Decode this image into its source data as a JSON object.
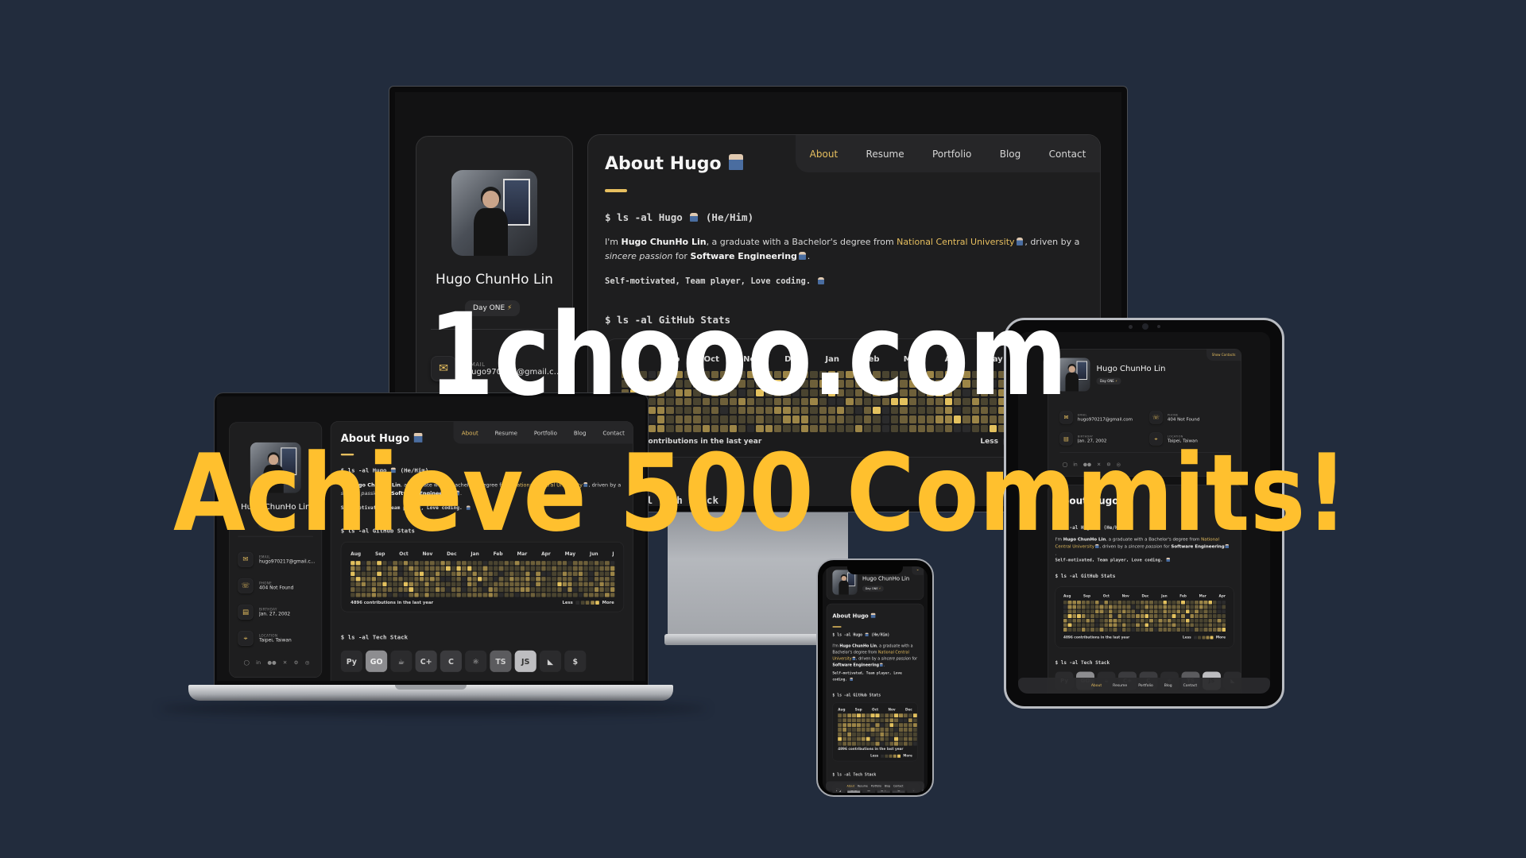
{
  "overlay": {
    "domain": "1chooo.com",
    "headline": "Achieve 500 Commits!"
  },
  "colors": {
    "background": "#222c3d",
    "accent": "#e7bf5f",
    "headline": "#ffc02e",
    "domain": "#ffffff",
    "card": "#1e1e1f",
    "contribution_levels": [
      "#2b2b2c",
      "#4a4430",
      "#6e603a",
      "#9c8547",
      "#e3c15e"
    ]
  },
  "site": {
    "name": "Hugo ChunHo Lin",
    "badge": "Day ONE",
    "badge_icon": "lightning-icon",
    "show_contacts": "Show Contacts",
    "nav": [
      "About",
      "Resume",
      "Portfolio",
      "Blog",
      "Contact"
    ],
    "active_nav": "About",
    "contacts": [
      {
        "label": "Email",
        "value": "hugo970217@gmail.com",
        "icon": "mail-icon"
      },
      {
        "label": "Phone",
        "value": "404 Not Found",
        "icon": "phone-icon"
      },
      {
        "label": "Birthday",
        "value": "Jan. 27, 2002",
        "icon": "calendar-icon"
      },
      {
        "label": "Location",
        "value": "Taipei, Taiwan",
        "icon": "location-pin-icon"
      }
    ],
    "socials": [
      "github-icon",
      "linkedin-icon",
      "medium-icon",
      "x-icon",
      "discord-icon",
      "gamepad-icon"
    ],
    "about": {
      "title": "About Hugo",
      "cmd_hugo": "$ ls -al Hugo",
      "pronouns": "(He/Him)",
      "para": [
        "I'm ",
        "Hugo ChunHo Lin",
        ", a graduate with a Bachelor's degree from ",
        "National Central University",
        ", driven by a ",
        "sincere passion",
        " for ",
        "Software Engineering",
        "."
      ],
      "motto": "Self-motivated, Team player, Love coding.",
      "stats_cmd": "$ ls -al GitHub Stats",
      "months": [
        "Aug",
        "Sep",
        "Oct",
        "Nov",
        "Dec",
        "Jan",
        "Feb",
        "Mar",
        "Apr",
        "May",
        "Jun",
        "J"
      ],
      "contributions": "4896 contributions in the last year",
      "less": "Less",
      "more": "More",
      "tech_cmd": "$ ls -al Tech Stack",
      "tech": [
        "python-icon",
        "go-icon",
        "java-icon",
        "cplusplus-icon",
        "c-icon",
        "react-icon",
        "typescript-icon",
        "javascript-icon",
        "flutter-icon",
        "bash-icon"
      ]
    }
  }
}
